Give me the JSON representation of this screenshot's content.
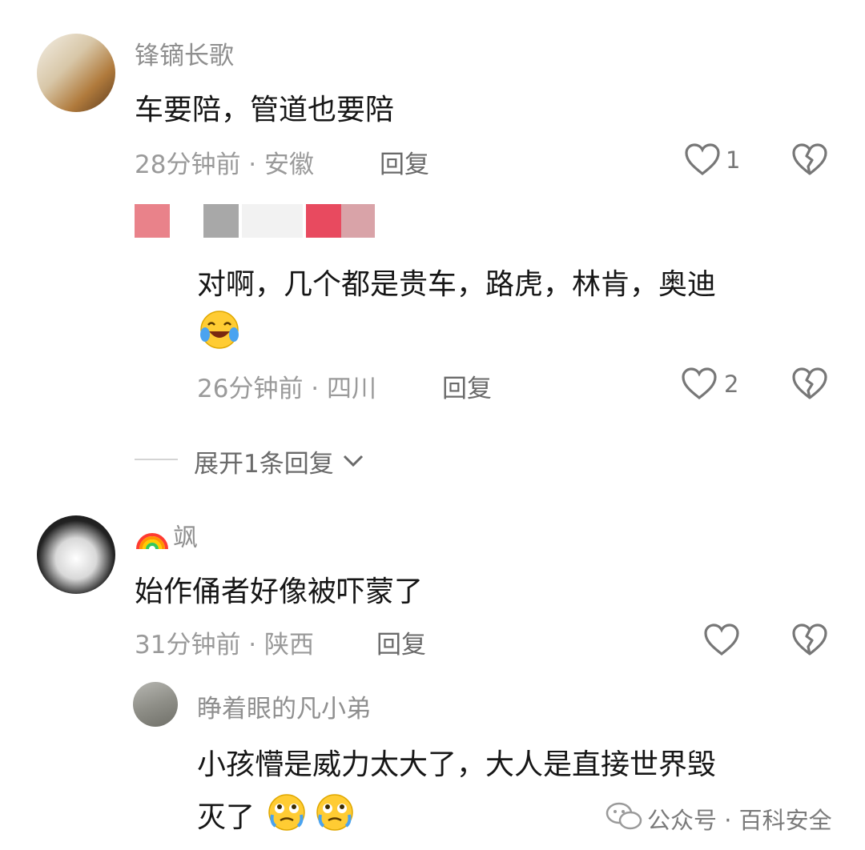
{
  "comments": [
    {
      "username": "锋镝长歌",
      "text": "车要陪，管道也要陪",
      "time_location": "28分钟前 · 安徽",
      "reply_label": "回复",
      "likes": "1"
    },
    {
      "username": "飒",
      "text": "始作俑者好像被吓蒙了",
      "time_location": "31分钟前 · 陕西",
      "reply_label": "回复",
      "likes": ""
    }
  ],
  "replies": [
    {
      "text_line1": "对啊，几个都是贵车，路虎，林肯，奥迪",
      "time_location": "26分钟前 · 四川",
      "reply_label": "回复",
      "likes": "2",
      "emoji": "laughing-crying-emoji"
    },
    {
      "username": "睁着眼的凡小弟",
      "text_line1": "小孩懵是威力太大了，大人是直接世界毁",
      "text_line2": "灭了",
      "emoji": "teary-emoji"
    }
  ],
  "expand": {
    "label": "展开1条回复"
  },
  "watermark": {
    "text": "公众号 · 百科安全"
  },
  "colors": {
    "mosaic_red": "#e84a5f",
    "mosaic_pink": "#d9a3a8",
    "mosaic_gray": "#a8a8a8"
  }
}
